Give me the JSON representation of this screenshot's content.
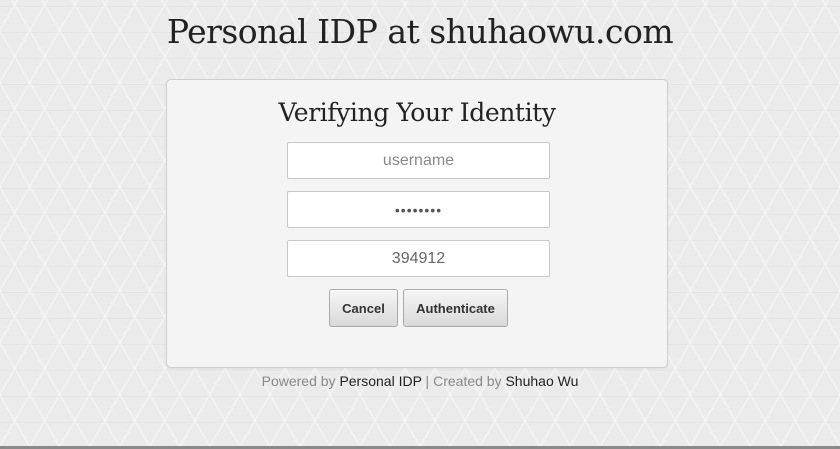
{
  "header": {
    "title": "Personal IDP at shuhaowu.com"
  },
  "card": {
    "title": "Verifying Your Identity",
    "username_placeholder": "username",
    "password_value": "••••••••",
    "otp_value": "394912",
    "cancel_label": "Cancel",
    "authenticate_label": "Authenticate"
  },
  "footer": {
    "powered_prefix": "Powered by ",
    "powered_link": "Personal IDP",
    "separator": " | ",
    "created_prefix": "Created by ",
    "created_link": "Shuhao Wu"
  },
  "colors": {
    "background": "#ebebeb",
    "card_background": "#f4f4f4",
    "text_dark": "#222222",
    "text_muted": "#888888"
  }
}
